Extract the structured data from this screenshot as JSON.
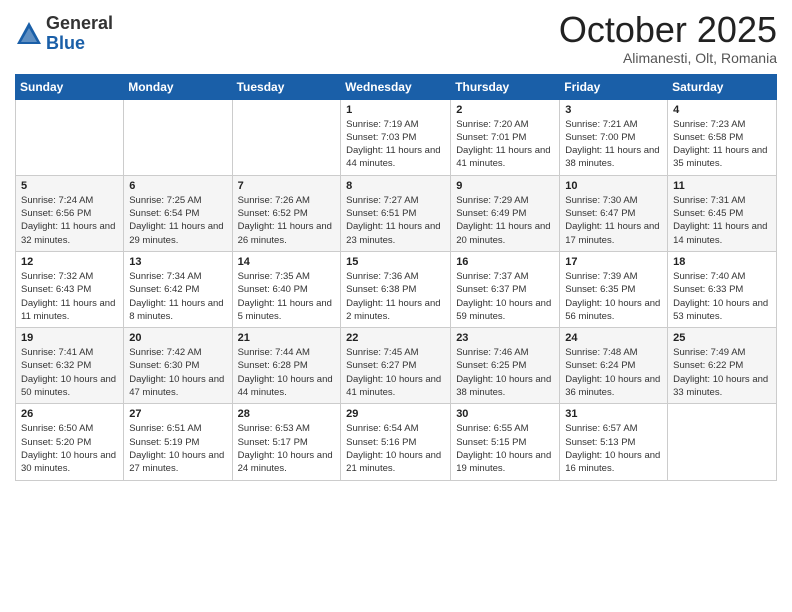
{
  "logo": {
    "general": "General",
    "blue": "Blue"
  },
  "title": "October 2025",
  "subtitle": "Alimanesti, Olt, Romania",
  "headers": [
    "Sunday",
    "Monday",
    "Tuesday",
    "Wednesday",
    "Thursday",
    "Friday",
    "Saturday"
  ],
  "weeks": [
    [
      {
        "day": "",
        "info": ""
      },
      {
        "day": "",
        "info": ""
      },
      {
        "day": "",
        "info": ""
      },
      {
        "day": "1",
        "info": "Sunrise: 7:19 AM\nSunset: 7:03 PM\nDaylight: 11 hours and 44 minutes."
      },
      {
        "day": "2",
        "info": "Sunrise: 7:20 AM\nSunset: 7:01 PM\nDaylight: 11 hours and 41 minutes."
      },
      {
        "day": "3",
        "info": "Sunrise: 7:21 AM\nSunset: 7:00 PM\nDaylight: 11 hours and 38 minutes."
      },
      {
        "day": "4",
        "info": "Sunrise: 7:23 AM\nSunset: 6:58 PM\nDaylight: 11 hours and 35 minutes."
      }
    ],
    [
      {
        "day": "5",
        "info": "Sunrise: 7:24 AM\nSunset: 6:56 PM\nDaylight: 11 hours and 32 minutes."
      },
      {
        "day": "6",
        "info": "Sunrise: 7:25 AM\nSunset: 6:54 PM\nDaylight: 11 hours and 29 minutes."
      },
      {
        "day": "7",
        "info": "Sunrise: 7:26 AM\nSunset: 6:52 PM\nDaylight: 11 hours and 26 minutes."
      },
      {
        "day": "8",
        "info": "Sunrise: 7:27 AM\nSunset: 6:51 PM\nDaylight: 11 hours and 23 minutes."
      },
      {
        "day": "9",
        "info": "Sunrise: 7:29 AM\nSunset: 6:49 PM\nDaylight: 11 hours and 20 minutes."
      },
      {
        "day": "10",
        "info": "Sunrise: 7:30 AM\nSunset: 6:47 PM\nDaylight: 11 hours and 17 minutes."
      },
      {
        "day": "11",
        "info": "Sunrise: 7:31 AM\nSunset: 6:45 PM\nDaylight: 11 hours and 14 minutes."
      }
    ],
    [
      {
        "day": "12",
        "info": "Sunrise: 7:32 AM\nSunset: 6:43 PM\nDaylight: 11 hours and 11 minutes."
      },
      {
        "day": "13",
        "info": "Sunrise: 7:34 AM\nSunset: 6:42 PM\nDaylight: 11 hours and 8 minutes."
      },
      {
        "day": "14",
        "info": "Sunrise: 7:35 AM\nSunset: 6:40 PM\nDaylight: 11 hours and 5 minutes."
      },
      {
        "day": "15",
        "info": "Sunrise: 7:36 AM\nSunset: 6:38 PM\nDaylight: 11 hours and 2 minutes."
      },
      {
        "day": "16",
        "info": "Sunrise: 7:37 AM\nSunset: 6:37 PM\nDaylight: 10 hours and 59 minutes."
      },
      {
        "day": "17",
        "info": "Sunrise: 7:39 AM\nSunset: 6:35 PM\nDaylight: 10 hours and 56 minutes."
      },
      {
        "day": "18",
        "info": "Sunrise: 7:40 AM\nSunset: 6:33 PM\nDaylight: 10 hours and 53 minutes."
      }
    ],
    [
      {
        "day": "19",
        "info": "Sunrise: 7:41 AM\nSunset: 6:32 PM\nDaylight: 10 hours and 50 minutes."
      },
      {
        "day": "20",
        "info": "Sunrise: 7:42 AM\nSunset: 6:30 PM\nDaylight: 10 hours and 47 minutes."
      },
      {
        "day": "21",
        "info": "Sunrise: 7:44 AM\nSunset: 6:28 PM\nDaylight: 10 hours and 44 minutes."
      },
      {
        "day": "22",
        "info": "Sunrise: 7:45 AM\nSunset: 6:27 PM\nDaylight: 10 hours and 41 minutes."
      },
      {
        "day": "23",
        "info": "Sunrise: 7:46 AM\nSunset: 6:25 PM\nDaylight: 10 hours and 38 minutes."
      },
      {
        "day": "24",
        "info": "Sunrise: 7:48 AM\nSunset: 6:24 PM\nDaylight: 10 hours and 36 minutes."
      },
      {
        "day": "25",
        "info": "Sunrise: 7:49 AM\nSunset: 6:22 PM\nDaylight: 10 hours and 33 minutes."
      }
    ],
    [
      {
        "day": "26",
        "info": "Sunrise: 6:50 AM\nSunset: 5:20 PM\nDaylight: 10 hours and 30 minutes."
      },
      {
        "day": "27",
        "info": "Sunrise: 6:51 AM\nSunset: 5:19 PM\nDaylight: 10 hours and 27 minutes."
      },
      {
        "day": "28",
        "info": "Sunrise: 6:53 AM\nSunset: 5:17 PM\nDaylight: 10 hours and 24 minutes."
      },
      {
        "day": "29",
        "info": "Sunrise: 6:54 AM\nSunset: 5:16 PM\nDaylight: 10 hours and 21 minutes."
      },
      {
        "day": "30",
        "info": "Sunrise: 6:55 AM\nSunset: 5:15 PM\nDaylight: 10 hours and 19 minutes."
      },
      {
        "day": "31",
        "info": "Sunrise: 6:57 AM\nSunset: 5:13 PM\nDaylight: 10 hours and 16 minutes."
      },
      {
        "day": "",
        "info": ""
      }
    ]
  ]
}
